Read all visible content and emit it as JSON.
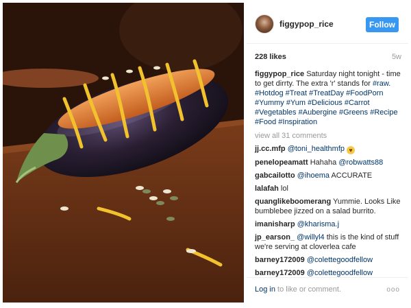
{
  "post": {
    "username": "figgypop_rice",
    "follow_label": "Follow",
    "likes": "228 likes",
    "age": "5w"
  },
  "caption": {
    "user": "figgypop_rice",
    "text": "Saturday night tonight - time to get dirrty. The extra 'r' stands for",
    "hashtags": [
      "#raw.",
      "#Hotdog",
      "#Treat",
      "#TreatDay",
      "#FoodPorn",
      "#Yummy",
      "#Yum",
      "#Delicious",
      "#Carrot",
      "#Vegetables",
      "#Aubergine",
      "#Greens",
      "#Recipe",
      "#Food",
      "#Inspiration"
    ]
  },
  "view_all": "view all 31 comments",
  "comments": [
    {
      "user": "jj.cc.mfp",
      "mention": "@toni_healthmfp",
      "text": "",
      "emoji": "😘"
    },
    {
      "user": "penelopeamatt",
      "text": "Hahaha",
      "mention": "@robwatts88"
    },
    {
      "user": "gabcailotto",
      "mention": "@ihoema",
      "text": "ACCURATE"
    },
    {
      "user": "lalafah",
      "text": "lol"
    },
    {
      "user": "quanglikeboomerang",
      "text": "Yummie. Looks Like bumblebee jizzed on a salad burrito."
    },
    {
      "user": "imanisharp",
      "mention": "@kharisma.j"
    },
    {
      "user": "jp_earson_",
      "mention": "@willyl4",
      "text": "this is the kind of stuff we're serving at cloverlea cafe"
    },
    {
      "user": "barney172009",
      "mention": "@colettegoodfellow"
    },
    {
      "user": "barney172009",
      "mention": "@colettegoodfellow"
    }
  ],
  "footer": {
    "login_link": "Log in",
    "login_rest": "to like or comment.",
    "more": "ooo"
  },
  "icons": {
    "more": "more-options-icon",
    "avatar": "profile-avatar"
  },
  "colors": {
    "follow_button": "#3897f0",
    "link": "#003569",
    "muted": "#999999"
  }
}
